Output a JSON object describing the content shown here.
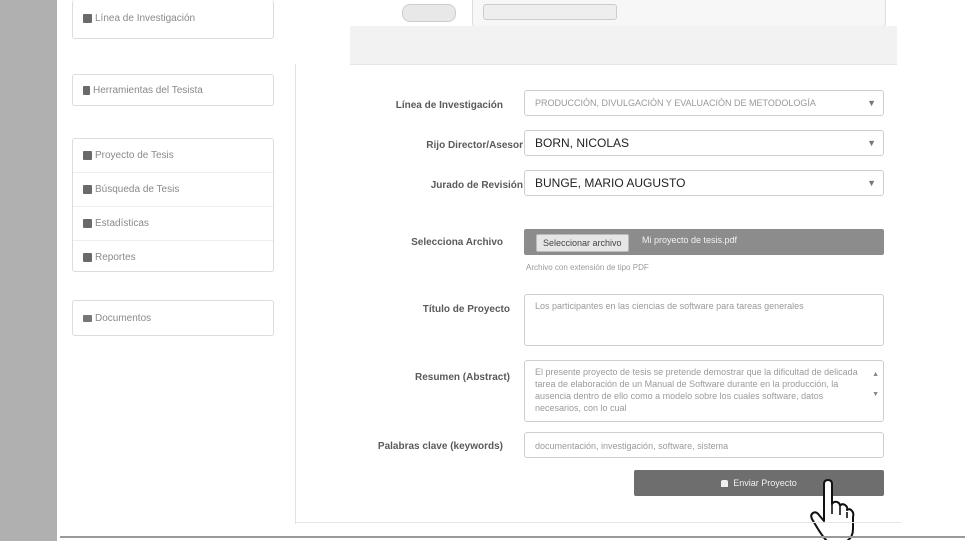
{
  "sidebar": {
    "top_item": {
      "label": "Línea de Investigación",
      "icon": "table-icon"
    },
    "tools_item": {
      "label": "Herramientas del Tesista",
      "icon": "bookmark-icon"
    },
    "group_items": [
      {
        "label": "Proyecto de Tesis",
        "icon": "grid-icon"
      },
      {
        "label": "Búsqueda de Tesis",
        "icon": "grid-icon"
      },
      {
        "label": "Estadísticas",
        "icon": "grid-icon"
      },
      {
        "label": "Reportes",
        "icon": "grid-icon"
      }
    ],
    "docs_item": {
      "label": "Documentos",
      "icon": "folder-icon"
    }
  },
  "form": {
    "linea_label": "Línea de Investigación",
    "linea_value": "PRODUCCIÓN, DIVULGACIÓN Y EVALUACIÓN DE METODOLOGÍA",
    "director_label": "Rijo Director/Asesor",
    "director_value": "BORN, NICOLAS",
    "jurado_label": "Jurado de Revisión",
    "jurado_value": "BUNGE, MARIO AUGUSTO",
    "archivo_label": "Selecciona Archivo",
    "archivo_button": "Seleccionar archivo",
    "archivo_name": "Mi proyecto de tesis.pdf",
    "archivo_hint": "Archivo con extensión de tipo PDF",
    "titulo_label": "Título de Proyecto",
    "titulo_value": "Los participantes en las ciencias de software para tareas generales",
    "resumen_label": "Resumen (Abstract)",
    "resumen_value": "El presente proyecto de tesis se pretende demostrar que la dificultad de delicada tarea de elaboración de un Manual de Software durante en la producción, la ausencia dentro de ello como a modelo sobre los cuales software, datos necesarios, con lo cual",
    "palabras_label": "Palabras clave (keywords)",
    "palabras_value": "documentación, investigación, software, sistema",
    "submit_label": "Enviar Proyecto"
  },
  "colors": {
    "left_bar": "#b0b0b0",
    "submit_bg": "#6e6e6e",
    "file_bg": "#8c8c8c"
  }
}
